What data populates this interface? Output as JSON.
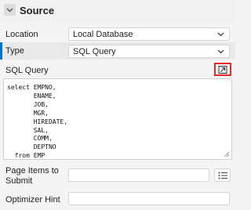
{
  "section": {
    "title": "Source"
  },
  "fields": {
    "location": {
      "label": "Location",
      "value": "Local Database"
    },
    "type": {
      "label": "Type",
      "value": "SQL Query"
    },
    "sql_query": {
      "label": "SQL Query",
      "code": "select EMPNO,\n       ENAME,\n       JOB,\n       MGR,\n       HIREDATE,\n       SAL,\n       COMM,\n       DEPTNO\n  from EMP"
    },
    "page_items": {
      "label": "Page Items to Submit",
      "value": ""
    },
    "optimizer_hint": {
      "label": "Optimizer Hint",
      "value": ""
    }
  },
  "colors": {
    "accent": "#0572ce",
    "highlight_border": "#e32a2a"
  },
  "icons": {
    "section_toggle": "chevron-down-icon",
    "select_arrow": "chevron-down-icon",
    "expand": "expand-arrow-icon",
    "list": "list-icon"
  }
}
